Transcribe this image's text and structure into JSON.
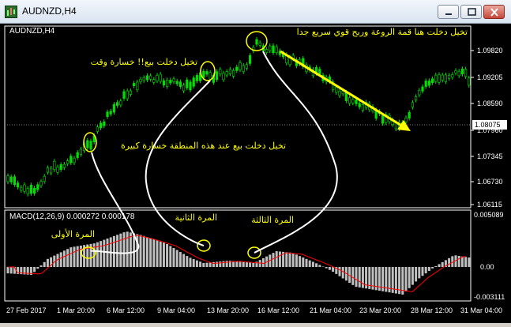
{
  "window": {
    "title": "AUDNZD,H4",
    "buttons": [
      "minimize",
      "restore",
      "close"
    ]
  },
  "chart": {
    "symbol_label": "AUDNZD,H4",
    "macd_label": "MACD(12,26,9) 0.000272 0.000178",
    "price_ticks": [
      "1.09820",
      "1.09205",
      "1.08590",
      "1.07960",
      "1.07345",
      "1.06730",
      "1.06115"
    ],
    "current_price": "1.08075",
    "macd_ticks": [
      "0.005089",
      "0.00",
      "-0.003111"
    ],
    "time_ticks": [
      "27 Feb 2017",
      "1 Mar 20:00",
      "6 Mar 12:00",
      "9 Mar 04:00",
      "13 Mar 20:00",
      "16 Mar 12:00",
      "21 Mar 04:00",
      "23 Mar 20:00",
      "28 Mar 12:00",
      "31 Mar 04:00"
    ],
    "colors": {
      "background": "#000000",
      "candles": "#00e000",
      "histogram": "#c0c0c0",
      "signal": "#ff0000",
      "annotation_text": "#ffff00",
      "current_price_bg": "#ffffff"
    },
    "annotations": {
      "top_right": "تخيل دخلت هنا قمة الروعة وربح قوي سريع جدا",
      "sell_loss": "تخيل دخلت بيع!! خسارة وقت",
      "big_loss": "تخيل دخلت بيع عند هذه المنطقة خسارة كبيرة",
      "first_time": "المرة الأولى",
      "second_time": "المرة الثانية",
      "third_time": "المرة الثالثة"
    }
  }
}
